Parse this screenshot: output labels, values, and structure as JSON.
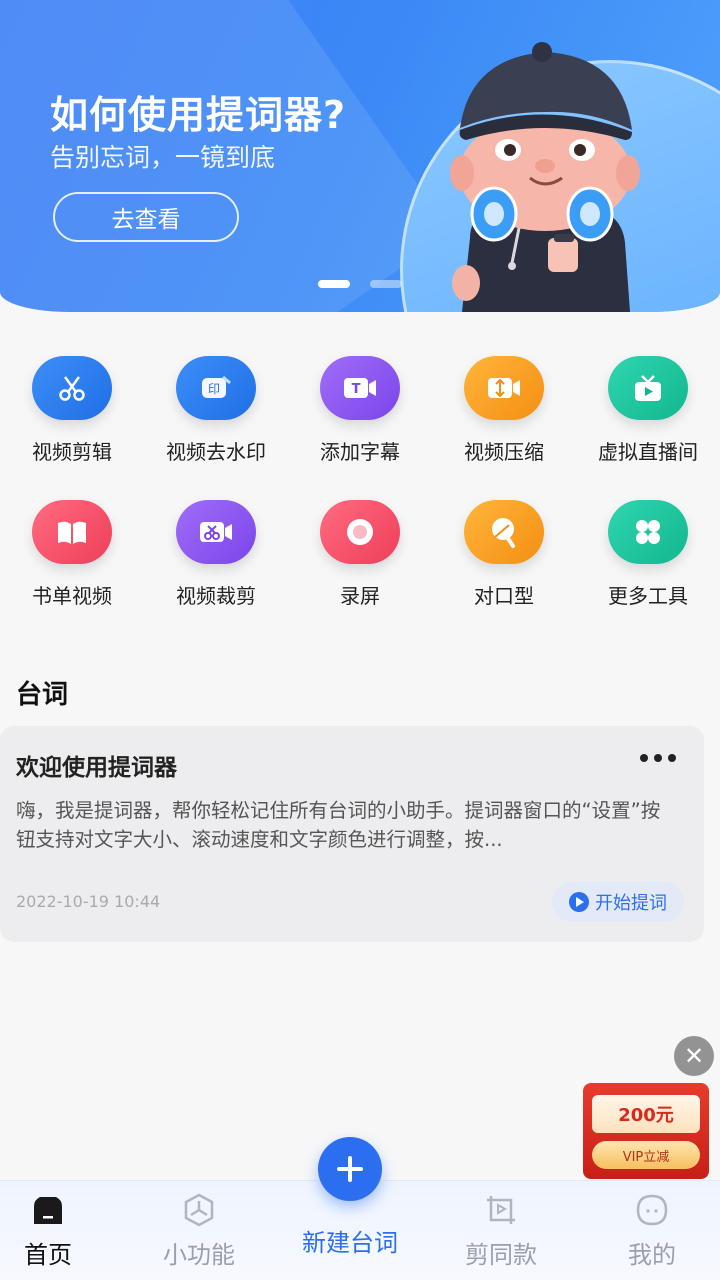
{
  "banner": {
    "title": "如何使用提词器?",
    "subtitle": "告别忘词，一镜到底",
    "button": "去查看",
    "active_dot": 0,
    "dot_count": 2
  },
  "tools": [
    {
      "label": "视频剪辑",
      "icon": "scissors-icon",
      "color": "#2b7df0"
    },
    {
      "label": "视频去水印",
      "icon": "watermark-stamp-icon",
      "color": "#2b7df0"
    },
    {
      "label": "添加字幕",
      "icon": "subtitle-icon",
      "color": "#8b5cf6"
    },
    {
      "label": "视频压缩",
      "icon": "compress-icon",
      "color": "#f7a325"
    },
    {
      "label": "虚拟直播间",
      "icon": "tv-live-icon",
      "color": "#19c8a0"
    },
    {
      "label": "书单视频",
      "icon": "book-icon",
      "color": "#f2546b"
    },
    {
      "label": "视频裁剪",
      "icon": "crop-video-icon",
      "color": "#8b5cf6"
    },
    {
      "label": "录屏",
      "icon": "record-icon",
      "color": "#f2546b"
    },
    {
      "label": "对口型",
      "icon": "lip-sync-icon",
      "color": "#f7a325"
    },
    {
      "label": "更多工具",
      "icon": "more-tools-icon",
      "color": "#19c8a0"
    }
  ],
  "section": {
    "title": "台词"
  },
  "card": {
    "title": "欢迎使用提词器",
    "body": "嗨，我是提词器，帮你轻松记住所有台词的小助手。提词器窗口的“设置”按钮支持对文字大小、滚动速度和文字颜色进行调整，按...",
    "date": "2022-10-19 10:44",
    "start_label": "开始提词"
  },
  "promo": {
    "amount": "200元",
    "vip": "VIP立减",
    "close": "✕"
  },
  "nav": {
    "home": "首页",
    "tools": "小功能",
    "new": "新建台词",
    "template": "剪同款",
    "mine": "我的",
    "fab_symbol": "+"
  },
  "colors": {
    "accent": "#2b6ff0",
    "background": "#f7f7f8"
  }
}
